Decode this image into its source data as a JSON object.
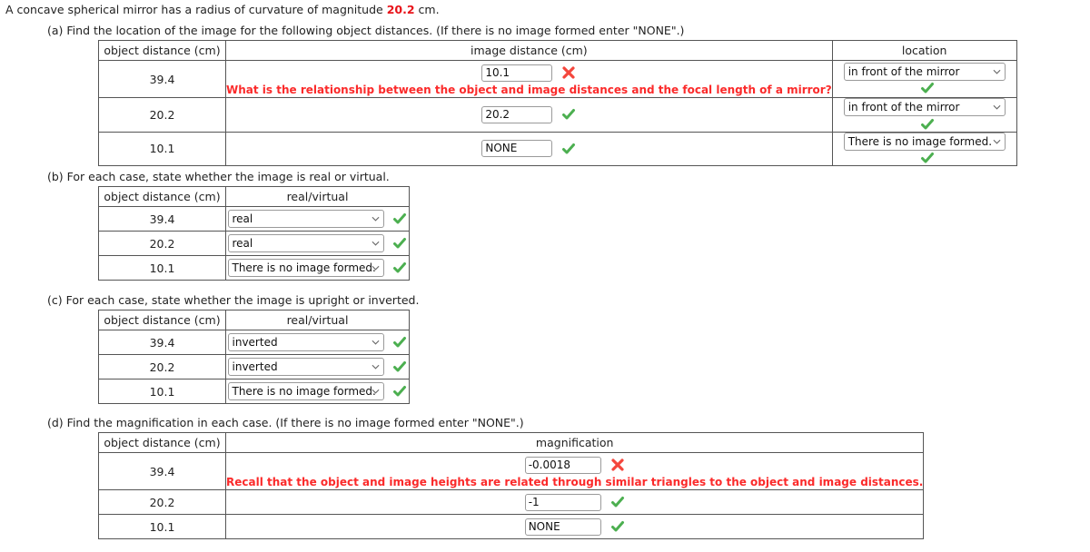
{
  "problem": {
    "text_before": "A concave spherical mirror has a radius of curvature of magnitude ",
    "value": "20.2",
    "text_after": " cm."
  },
  "icons": {
    "correct": "green-check-icon",
    "incorrect": "red-x-icon",
    "dropdown": "chevron-down-icon"
  },
  "colors": {
    "red_value": "#e8131a",
    "feedback_red": "#fb2a2a",
    "check_green": "#4caf50",
    "x_red": "#f4463c",
    "border": "#555555"
  },
  "parts": [
    {
      "id": "a",
      "label": "(a) Find the location of the image for the following object distances. (If there is no image formed enter \"NONE\".)",
      "headers": [
        "object distance (cm)",
        "image distance (cm)",
        "location"
      ],
      "rows": [
        {
          "object_distance": "39.4",
          "image_distance": "10.1",
          "image_status": "incorrect",
          "feedback": "What is the relationship between the object and image distances and the focal length of a mirror?",
          "location": "in front of the mirror",
          "location_status": "correct"
        },
        {
          "object_distance": "20.2",
          "image_distance": "20.2",
          "image_status": "correct",
          "feedback": "",
          "location": "in front of the mirror",
          "location_status": "correct"
        },
        {
          "object_distance": "10.1",
          "image_distance": "NONE",
          "image_status": "correct",
          "feedback": "",
          "location": "There is no image formed.",
          "location_status": "correct"
        }
      ]
    },
    {
      "id": "b",
      "label": "(b) For each case, state whether the image is real or virtual.",
      "headers": [
        "object distance (cm)",
        "real/virtual"
      ],
      "rows": [
        {
          "object_distance": "39.4",
          "answer": "real",
          "status": "correct"
        },
        {
          "object_distance": "20.2",
          "answer": "real",
          "status": "correct"
        },
        {
          "object_distance": "10.1",
          "answer": "There is no image formed.",
          "status": "correct"
        }
      ]
    },
    {
      "id": "c",
      "label": "(c) For each case, state whether the image is upright or inverted.",
      "headers": [
        "object distance (cm)",
        "real/virtual"
      ],
      "rows": [
        {
          "object_distance": "39.4",
          "answer": "inverted",
          "status": "correct"
        },
        {
          "object_distance": "20.2",
          "answer": "inverted",
          "status": "correct"
        },
        {
          "object_distance": "10.1",
          "answer": "There is no image formed.",
          "status": "correct"
        }
      ]
    },
    {
      "id": "d",
      "label": "(d) Find the magnification in each case. (If there is no image formed enter \"NONE\".)",
      "headers": [
        "object distance (cm)",
        "magnification"
      ],
      "rows": [
        {
          "object_distance": "39.4",
          "answer": "-0.0018",
          "status": "incorrect",
          "feedback": "Recall that the object and image heights are related through similar triangles to the object and image distances."
        },
        {
          "object_distance": "20.2",
          "answer": "-1",
          "status": "correct",
          "feedback": ""
        },
        {
          "object_distance": "10.1",
          "answer": "NONE",
          "status": "correct",
          "feedback": ""
        }
      ]
    }
  ]
}
